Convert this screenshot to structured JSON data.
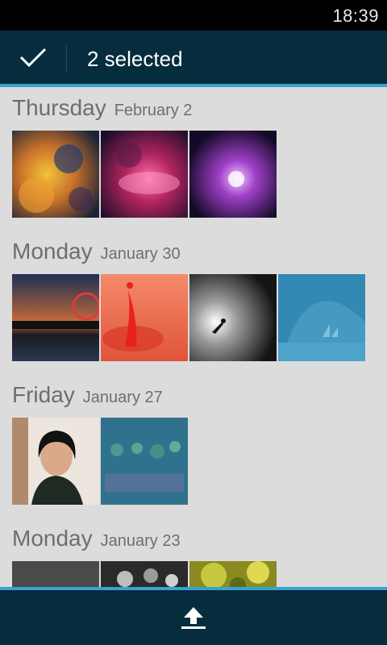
{
  "status_bar": {
    "time": "18:39"
  },
  "action_bar": {
    "title": "2 selected",
    "done_icon": "checkmark-icon"
  },
  "groups": [
    {
      "day": "Thursday",
      "date": "February 2"
    },
    {
      "day": "Monday",
      "date": "January 30"
    },
    {
      "day": "Friday",
      "date": "January 27"
    },
    {
      "day": "Monday",
      "date": "January 23"
    }
  ],
  "bottom_bar": {
    "share_icon": "upload-icon"
  },
  "colors": {
    "bar": "#052d3d",
    "accent": "#3aa2cf",
    "background": "#dcdcdc"
  }
}
